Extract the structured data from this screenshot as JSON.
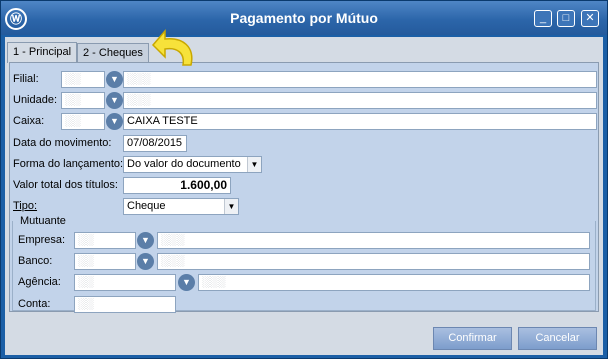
{
  "window": {
    "title": "Pagamento por Mútuo",
    "minimize_label": "_",
    "maximize_label": "□",
    "close_label": "✕"
  },
  "tabs": [
    {
      "label": "1 - Principal",
      "active": true
    },
    {
      "label": "2 - Cheques",
      "active": false
    }
  ],
  "form": {
    "filial_label": "Filial:",
    "unidade_label": "Unidade:",
    "caixa_label": "Caixa:",
    "caixa_value": "CAIXA TESTE",
    "data_label": "Data do movimento:",
    "data_value": "07/08/2015",
    "forma_label": "Forma do lançamento:",
    "forma_value": "Do valor do documento",
    "valor_label": "Valor total dos títulos:",
    "valor_value": "1.600,00",
    "tipo_label": "Tipo:",
    "tipo_value": "Cheque"
  },
  "mutuante": {
    "legend": "Mutuante",
    "empresa_label": "Empresa:",
    "banco_label": "Banco:",
    "agencia_label": "Agência:",
    "conta_label": "Conta:"
  },
  "buttons": {
    "confirmar": "Confirmar",
    "cancelar": "Cancelar"
  },
  "colors": {
    "title_bar": "#2c66aa",
    "panel": "#c2d3ea",
    "button": "#7d9dcc",
    "annotation_arrow": "#f7e23a"
  }
}
